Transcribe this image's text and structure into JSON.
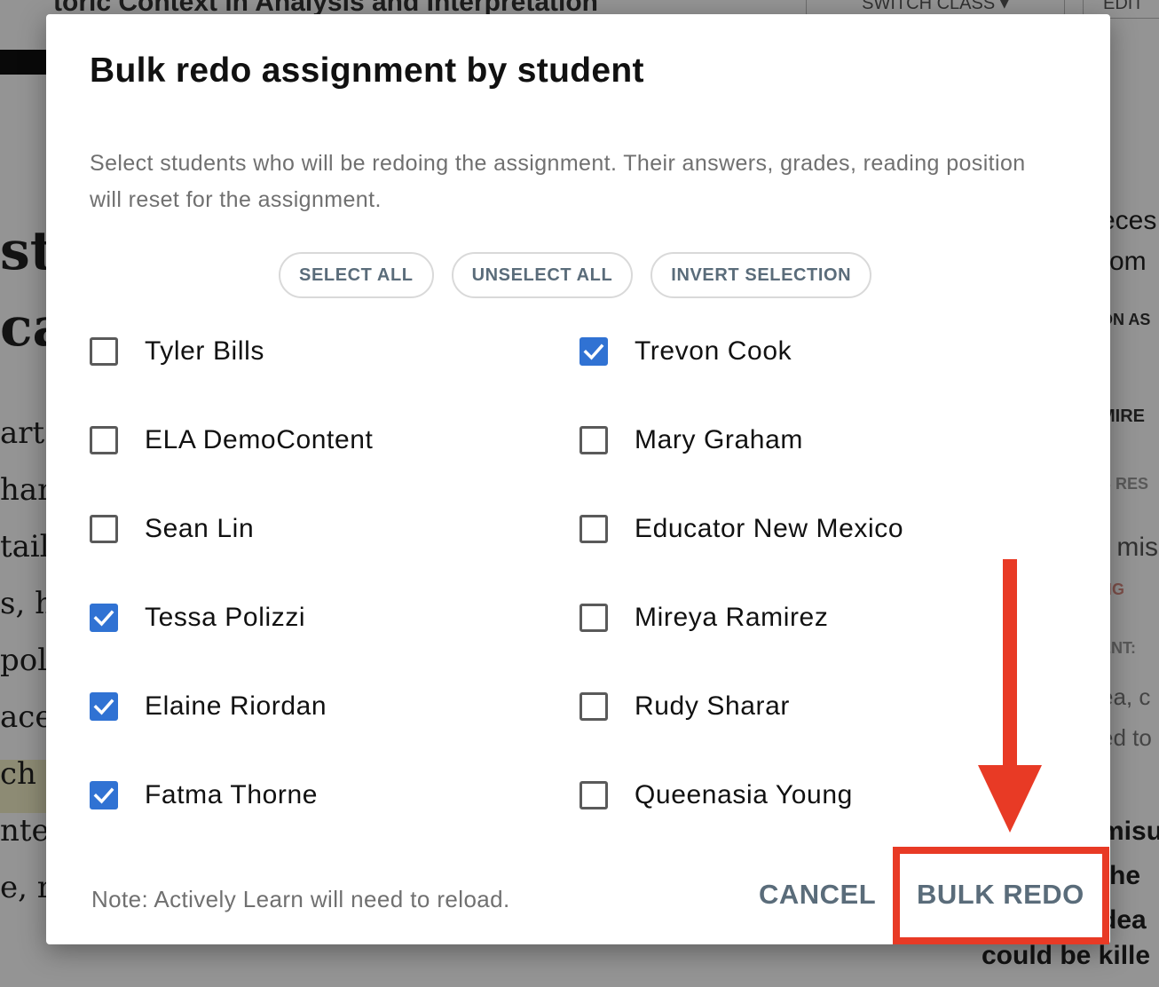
{
  "background": {
    "title": "toric Context in Analysis and Interpretation",
    "switch_class": "SWITCH CLASS",
    "edit": "EDIT",
    "left_big": [
      "sto",
      "cat"
    ],
    "left_lines": [
      "art",
      "har",
      "tail",
      "s, h",
      "pol",
      "ace",
      "ch a",
      "nte",
      "e, ra"
    ],
    "right_texts": [
      "eces",
      "rom",
      "ON AS",
      "MIRE",
      "S RES",
      "r mis",
      "NG",
      "ENT:",
      "ea, c",
      "ed to",
      "misu",
      "the",
      "dea"
    ],
    "bottom_text": "could be kille"
  },
  "modal": {
    "title": "Bulk redo assignment by student",
    "description": "Select students who will be redoing the assignment. Their answers, grades, reading position will reset for the assignment.",
    "select_all": "SELECT ALL",
    "unselect_all": "UNSELECT ALL",
    "invert_selection": "INVERT SELECTION",
    "students": [
      {
        "name": "Tyler Bills",
        "checked": false
      },
      {
        "name": "Trevon Cook",
        "checked": true
      },
      {
        "name": "ELA DemoContent",
        "checked": false
      },
      {
        "name": "Mary Graham",
        "checked": false
      },
      {
        "name": "Sean Lin",
        "checked": false
      },
      {
        "name": "Educator New Mexico",
        "checked": false
      },
      {
        "name": "Tessa Polizzi",
        "checked": true
      },
      {
        "name": "Mireya Ramirez",
        "checked": false
      },
      {
        "name": "Elaine Riordan",
        "checked": true
      },
      {
        "name": "Rudy Sharar",
        "checked": false
      },
      {
        "name": "Fatma Thorne",
        "checked": true
      },
      {
        "name": "Queenasia Young",
        "checked": false
      }
    ],
    "note": "Note: Actively Learn will need to reload.",
    "cancel": "CANCEL",
    "bulk_redo": "BULK REDO"
  },
  "colors": {
    "checkbox_checked": "#3072d3",
    "button_text": "#5a6c7a",
    "annotation": "#e83a25"
  }
}
